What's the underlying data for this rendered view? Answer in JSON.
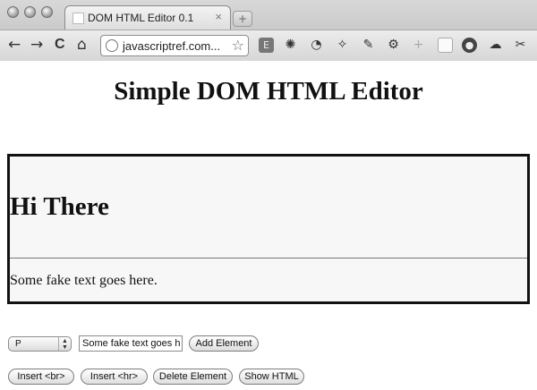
{
  "browser": {
    "tab_title": "DOM HTML Editor 0.1",
    "tab_close": "×",
    "new_tab": "+",
    "url": "javascriptref.com...",
    "nav": {
      "back": "←",
      "forward": "→",
      "reload": "C",
      "home": "⌂"
    },
    "bookmark_star": "☆",
    "extension_icons": [
      "evernote-icon",
      "sunburst-icon",
      "timer-icon",
      "magic-wand-icon",
      "pin-icon",
      "gear-icon",
      "thumb-icon",
      "window-icon",
      "record-icon",
      "cloud-icon",
      "wrench-icon"
    ]
  },
  "page": {
    "title": "Simple DOM HTML Editor"
  },
  "editor": {
    "heading": "Hi There",
    "paragraph": "Some fake text goes here."
  },
  "controls": {
    "element_select_value": "P",
    "text_input_value": "Some fake text goes h",
    "add_element_label": "Add Element",
    "insert_br_label": "Insert <br>",
    "insert_hr_label": "Insert <hr>",
    "delete_element_label": "Delete Element",
    "show_html_label": "Show HTML"
  }
}
